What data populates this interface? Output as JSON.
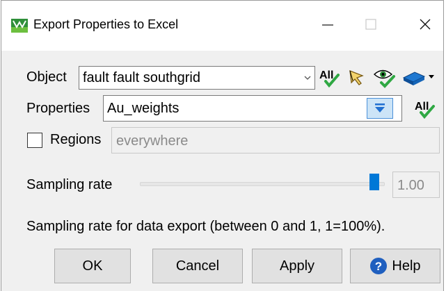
{
  "window": {
    "title": "Export Properties to Excel",
    "icon": "app-logo-icon",
    "controls": [
      "minimize-icon",
      "maximize-icon",
      "close-icon"
    ]
  },
  "object": {
    "label": "Object",
    "value": "fault fault southgrid",
    "toolbar": {
      "all_label": "All",
      "icons": [
        "select-all-icon",
        "pick-cursor-icon",
        "visible-eye-icon",
        "layers-icon"
      ]
    }
  },
  "properties": {
    "label": "Properties",
    "value": "Au_weights",
    "all_label": "All",
    "filter_icon": "filter-dropdown-icon"
  },
  "regions": {
    "label": "Regions",
    "value": "everywhere",
    "checked": false
  },
  "sampling": {
    "label": "Sampling rate",
    "value": "1.00",
    "fraction": 1.0,
    "note": "Sampling rate for data export (between 0 and 1, 1=100%)."
  },
  "buttons": {
    "ok": "OK",
    "cancel": "Cancel",
    "apply": "Apply",
    "help": "Help"
  },
  "colors": {
    "accent": "#0078d7",
    "check_green": "#2fa843",
    "help_blue": "#1f5fbf"
  }
}
